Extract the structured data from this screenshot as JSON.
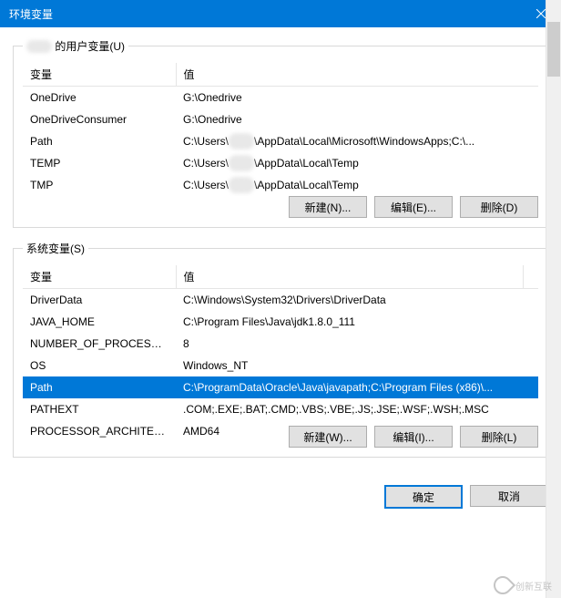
{
  "window": {
    "title": "环境变量"
  },
  "user_section": {
    "legend_prefix_hidden": "xxxx",
    "legend_suffix": " 的用户变量(U)",
    "headers": {
      "name": "变量",
      "value": "值"
    },
    "rows": [
      {
        "name": "OneDrive",
        "value": "G:\\Onedrive"
      },
      {
        "name": "OneDriveConsumer",
        "value": "G:\\Onedrive"
      },
      {
        "name": "Path",
        "value_pre": "C:\\Users\\",
        "value_post": "\\AppData\\Local\\Microsoft\\WindowsApps;C:\\..."
      },
      {
        "name": "TEMP",
        "value_pre": "C:\\Users\\",
        "value_post": "\\AppData\\Local\\Temp"
      },
      {
        "name": "TMP",
        "value_pre": "C:\\Users\\",
        "value_post": "\\AppData\\Local\\Temp"
      }
    ],
    "buttons": {
      "new": "新建(N)...",
      "edit": "编辑(E)...",
      "delete": "删除(D)"
    }
  },
  "system_section": {
    "legend": "系统变量(S)",
    "headers": {
      "name": "变量",
      "value": "值"
    },
    "rows": [
      {
        "name": "DriverData",
        "value": "C:\\Windows\\System32\\Drivers\\DriverData"
      },
      {
        "name": "JAVA_HOME",
        "value": "C:\\Program Files\\Java\\jdk1.8.0_111"
      },
      {
        "name": "NUMBER_OF_PROCESSORS",
        "value": "8"
      },
      {
        "name": "OS",
        "value": "Windows_NT"
      },
      {
        "name": "Path",
        "value": "C:\\ProgramData\\Oracle\\Java\\javapath;C:\\Program Files (x86)\\...",
        "selected": true
      },
      {
        "name": "PATHEXT",
        "value": ".COM;.EXE;.BAT;.CMD;.VBS;.VBE;.JS;.JSE;.WSF;.WSH;.MSC"
      },
      {
        "name": "PROCESSOR_ARCHITECT...",
        "value": "AMD64"
      }
    ],
    "buttons": {
      "new": "新建(W)...",
      "edit": "编辑(I)...",
      "delete": "删除(L)"
    }
  },
  "footer": {
    "ok": "确定",
    "cancel": "取消"
  },
  "watermark": {
    "text": "创新互联"
  }
}
